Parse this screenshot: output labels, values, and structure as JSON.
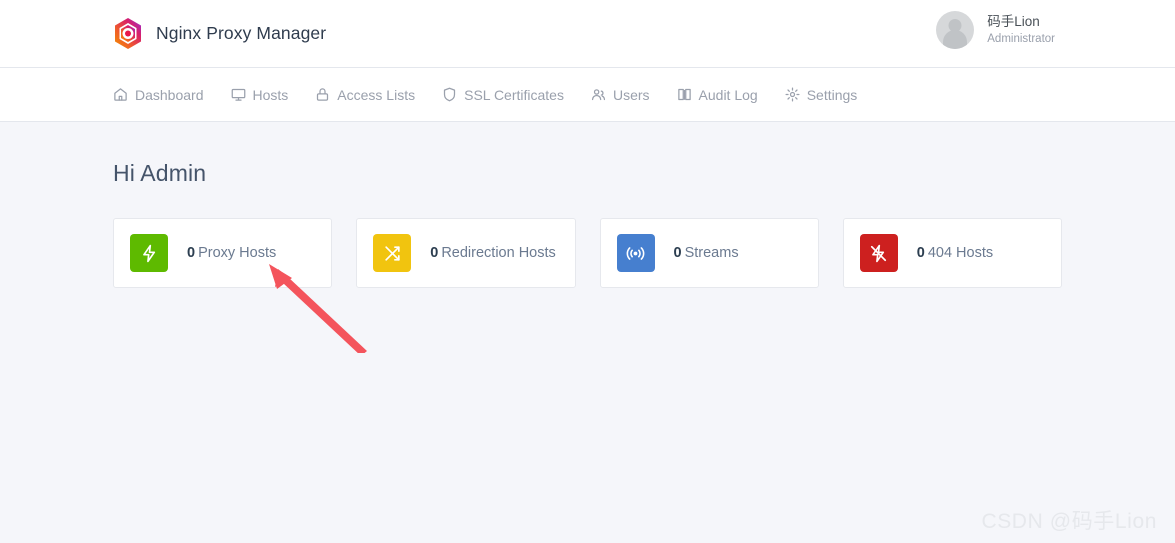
{
  "header": {
    "logo_icon": "nginx-proxy-manager-hexagon-logo",
    "title": "Nginx Proxy Manager",
    "user": {
      "avatar_icon": "user-avatar-placeholder",
      "name": "码手Lion",
      "role": "Administrator"
    }
  },
  "nav": {
    "items": [
      {
        "label": "Dashboard",
        "icon": "home-icon"
      },
      {
        "label": "Hosts",
        "icon": "monitor-icon"
      },
      {
        "label": "Access Lists",
        "icon": "lock-icon"
      },
      {
        "label": "SSL Certificates",
        "icon": "shield-icon"
      },
      {
        "label": "Users",
        "icon": "users-icon"
      },
      {
        "label": "Audit Log",
        "icon": "book-icon"
      },
      {
        "label": "Settings",
        "icon": "gear-icon"
      }
    ]
  },
  "main": {
    "greeting": "Hi Admin",
    "cards": [
      {
        "count": "0",
        "label": "Proxy Hosts",
        "icon": "lightning-bolt-icon",
        "color": "#5eba00"
      },
      {
        "count": "0",
        "label": "Redirection Hosts",
        "icon": "shuffle-arrows-icon",
        "color": "#f1c40f"
      },
      {
        "count": "0",
        "label": "Streams",
        "icon": "broadcast-signal-icon",
        "color": "#467fcf"
      },
      {
        "count": "0",
        "label": "404 Hosts",
        "icon": "lightning-bolt-off-icon",
        "color": "#cd201f"
      }
    ]
  },
  "annotation": {
    "arrow_icon": "red-pointer-arrow",
    "color": "#f4545c"
  },
  "watermark": {
    "text": "CSDN @码手Lion"
  },
  "theme": {
    "page_background": "#f5f6fa",
    "surface": "#ffffff",
    "border": "#e4e7ed",
    "muted_text": "#9aa0ac",
    "heading_text": "#45546a"
  }
}
